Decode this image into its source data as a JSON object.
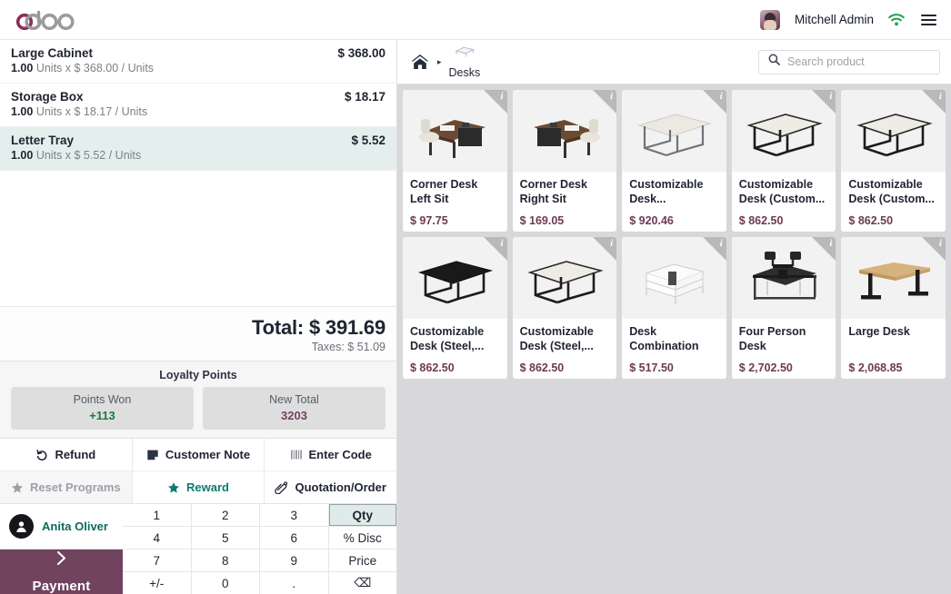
{
  "navbar": {
    "logo_text": "odoo",
    "user_name": "Mitchell Admin",
    "wifi_icon": "wifi-icon",
    "menu_icon": "hamburger-menu-icon"
  },
  "order": {
    "lines": [
      {
        "name": "Large Cabinet",
        "qty": "1.00",
        "detail": "Units x $ 368.00 / Units",
        "price": "$ 368.00",
        "selected": false
      },
      {
        "name": "Storage Box",
        "qty": "1.00",
        "detail": "Units x $ 18.17 / Units",
        "price": "$ 18.17",
        "selected": false
      },
      {
        "name": "Letter Tray",
        "qty": "1.00",
        "detail": "Units x $ 5.52 / Units",
        "price": "$ 5.52",
        "selected": true
      }
    ],
    "total_label": "Total: $ 391.69",
    "taxes_label": "Taxes: $ 51.09"
  },
  "loyalty": {
    "title": "Loyalty Points",
    "cards": [
      {
        "label": "Points Won",
        "value": "+113",
        "value_color": "green"
      },
      {
        "label": "New Total",
        "value": "3203",
        "value_color": "plum"
      }
    ]
  },
  "actions_row1": [
    {
      "label": "Refund",
      "icon": "refund-undo-icon",
      "disabled": false,
      "teal": false
    },
    {
      "label": "Customer Note",
      "icon": "note-icon",
      "disabled": false,
      "teal": false
    },
    {
      "label": "Enter Code",
      "icon": "barcode-icon",
      "disabled": false,
      "teal": false
    }
  ],
  "actions_row2": [
    {
      "label": "Reset Programs",
      "icon": "star-icon",
      "disabled": true,
      "teal": false
    },
    {
      "label": "Reward",
      "icon": "star-icon",
      "disabled": false,
      "teal": true
    },
    {
      "label": "Quotation/Order",
      "icon": "paperclip-icon",
      "disabled": false,
      "teal": false
    }
  ],
  "customer": {
    "name": "Anita Oliver",
    "icon": "person-icon"
  },
  "payment": {
    "label": "Payment",
    "icon": "chevron-right-icon",
    "color": "#71435f"
  },
  "numpad": {
    "keys": [
      {
        "label": "1",
        "active": false
      },
      {
        "label": "2",
        "active": false
      },
      {
        "label": "3",
        "active": false
      },
      {
        "label": "Qty",
        "active": true
      },
      {
        "label": "4",
        "active": false
      },
      {
        "label": "5",
        "active": false
      },
      {
        "label": "6",
        "active": false
      },
      {
        "label": "% Disc",
        "active": false
      },
      {
        "label": "7",
        "active": false
      },
      {
        "label": "8",
        "active": false
      },
      {
        "label": "9",
        "active": false
      },
      {
        "label": "Price",
        "active": false
      },
      {
        "label": "+/-",
        "active": false
      },
      {
        "label": "0",
        "active": false
      },
      {
        "label": ".",
        "active": false
      },
      {
        "label": "⌫",
        "active": false
      }
    ]
  },
  "product_header": {
    "home_icon": "home-icon",
    "separator": "▸",
    "category": "Desks",
    "category_icon": "desk-thumbnail-icon",
    "search_icon": "search-icon",
    "search_placeholder": "Search product",
    "search_value": ""
  },
  "products": [
    {
      "name": "Corner Desk Left Sit",
      "price": "$ 97.75",
      "img": "corner-desk-left",
      "info": "i"
    },
    {
      "name": "Corner Desk Right Sit",
      "price": "$ 169.05",
      "img": "corner-desk-right",
      "info": "i"
    },
    {
      "name": "Customizable Desk...",
      "price": "$ 920.46",
      "img": "desk-white-gray",
      "info": "i"
    },
    {
      "name": "Customizable Desk (Custom...",
      "price": "$ 862.50",
      "img": "desk-white-black",
      "info": "i"
    },
    {
      "name": "Customizable Desk (Custom...",
      "price": "$ 862.50",
      "img": "desk-white-black",
      "info": "i"
    },
    {
      "name": "Customizable Desk (Steel,...",
      "price": "$ 862.50",
      "img": "desk-black-top",
      "info": "i"
    },
    {
      "name": "Customizable Desk (Steel,...",
      "price": "$ 862.50",
      "img": "desk-white-black",
      "info": "i"
    },
    {
      "name": "Desk Combination",
      "price": "$ 517.50",
      "img": "desk-combination",
      "info": "i"
    },
    {
      "name": "Four Person Desk",
      "price": "$ 2,702.50",
      "img": "four-person-desk",
      "info": "i"
    },
    {
      "name": "Large Desk",
      "price": "$ 2,068.85",
      "img": "large-desk",
      "info": "i"
    }
  ]
}
